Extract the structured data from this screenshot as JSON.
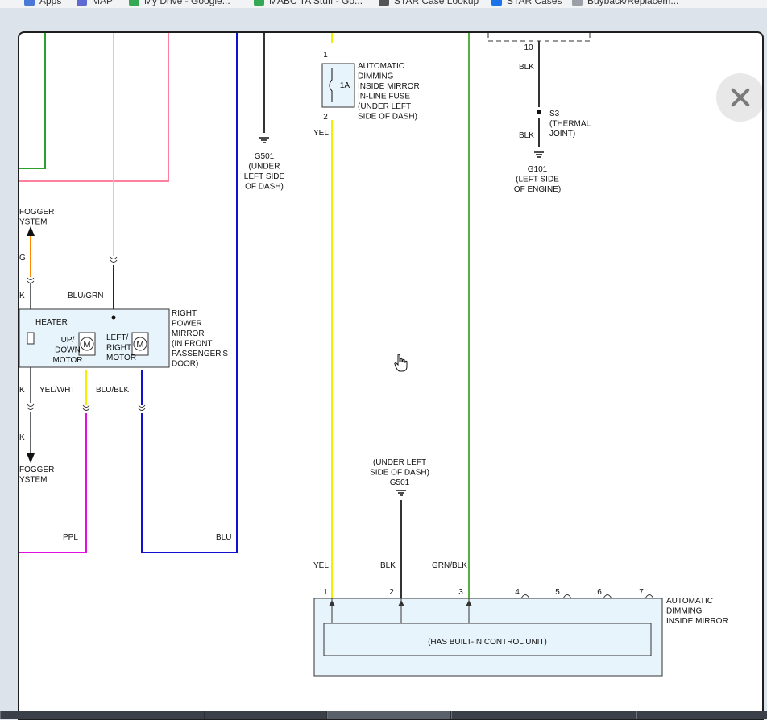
{
  "bookmarks": [
    {
      "label": "Apps",
      "color": "#4a78d6"
    },
    {
      "label": "MAP",
      "color": "#5f6bd3"
    },
    {
      "label": "My Drive - Google...",
      "color": "#34a853"
    },
    {
      "label": "MABC TA Stuff - Go...",
      "color": "#34a853"
    },
    {
      "label": "STAR Case Lookup",
      "color": "#555555"
    },
    {
      "label": "STAR Cases",
      "color": "#1a73e8"
    },
    {
      "label": "Buyback/Replacem...",
      "color": "#9aa0a6"
    }
  ],
  "diagram": {
    "rear_defogger_top": "FOGGER\nYSTEM",
    "rear_defogger_bottom": "FOGGER\nYSTEM",
    "wire_g": "G",
    "wire_k_1": "K",
    "wire_k_2": "K",
    "wire_k_3": "K",
    "wire_blu_grn": "BLU/GRN",
    "wire_yel_wht": "YEL/WHT",
    "wire_blu_blk": "BLU/BLK",
    "wire_ppl": "PPL",
    "wire_blu": "BLU",
    "heater": "HEATER",
    "up_down_motor": "UP/\nDOWN\nMOTOR",
    "left_right_motor": "LEFT/\nRIGHT\nMOTOR",
    "motor_symbol": "M",
    "right_power_mirror": "RIGHT\nPOWER\nMIRROR\n(IN FRONT\nPASSENGER'S\nDOOR)",
    "g501_top": "G501\n(UNDER\nLEFT SIDE\nOF DASH)",
    "fuse_pin_1": "1",
    "fuse_pin_2": "2",
    "fuse_rating": "1A",
    "fuse_label": "AUTOMATIC\nDIMMING\nINSIDE MIRROR\nIN-LINE FUSE\n(UNDER LEFT\nSIDE OF DASH)",
    "wire_yel_top": "YEL",
    "pin_10": "10",
    "wire_blk_top": "BLK",
    "s3_label": "S3\n(THERMAL\nJOINT)",
    "wire_blk_s3": "BLK",
    "g101": "G101\n(LEFT SIDE\nOF ENGINE)",
    "g501_bottom": "(UNDER LEFT\nSIDE OF DASH)\nG501",
    "wire_yel_bottom": "YEL",
    "wire_blk_bottom": "BLK",
    "wire_grn_blk": "GRN/BLK",
    "connector_pins": [
      "1",
      "2",
      "3",
      "4",
      "5",
      "6",
      "7"
    ],
    "mirror_label": "AUTOMATIC\nDIMMING\nINSIDE MIRROR",
    "control_unit": "(HAS BUILT-IN CONTROL UNIT)"
  },
  "colors": {
    "green": "#2ca02c",
    "pink": "#ff7f9e",
    "white_wire": "#cfcfcf",
    "blue": "#1010d0",
    "dark": "#333333",
    "yellow": "#f0f000",
    "orange": "#ff8800",
    "magenta": "#e010e0",
    "lime": "#55b040",
    "box_fill": "#e8f4fb"
  }
}
